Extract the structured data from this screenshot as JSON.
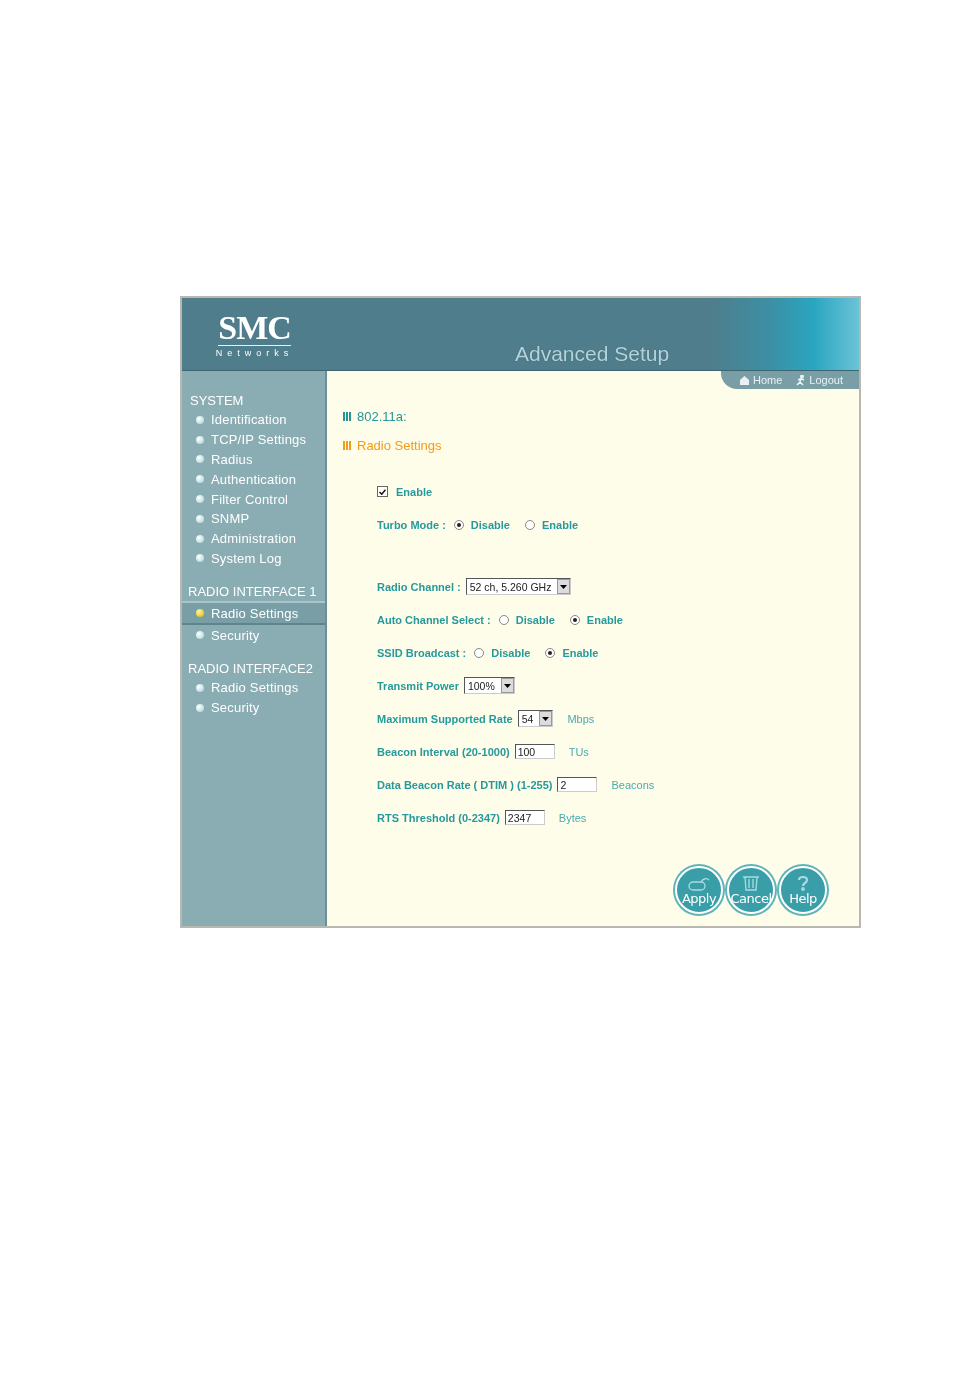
{
  "header": {
    "logo": "SMC",
    "logo_sub": "Networks",
    "title": "Advanced Setup",
    "nav": [
      {
        "kind": "home",
        "label": "Home"
      },
      {
        "kind": "logout",
        "label": "Logout"
      }
    ]
  },
  "sidebar": {
    "sections": [
      {
        "title": "SYSTEM",
        "items": [
          {
            "label": "Identification",
            "selected": false
          },
          {
            "label": "TCP/IP Settings",
            "selected": false
          },
          {
            "label": "Radius",
            "selected": false
          },
          {
            "label": "Authentication",
            "selected": false
          },
          {
            "label": "Filter Control",
            "selected": false
          },
          {
            "label": "SNMP",
            "selected": false
          },
          {
            "label": "Administration",
            "selected": false
          },
          {
            "label": "System Log",
            "selected": false
          }
        ]
      },
      {
        "title": "RADIO INTERFACE 1",
        "items": [
          {
            "label": "Radio Settings",
            "selected": true
          },
          {
            "label": "Security",
            "selected": false
          }
        ]
      },
      {
        "title": "RADIO INTERFACE2",
        "items": [
          {
            "label": "Radio Settings",
            "selected": false
          },
          {
            "label": "Security",
            "selected": false
          }
        ]
      }
    ]
  },
  "content": {
    "section": "802.11a:",
    "heading": "Radio Settings",
    "enable": {
      "label": "Enable",
      "checked": true
    },
    "mode_fields": [
      {
        "kind": "radio",
        "label": "Turbo Mode :",
        "options": [
          {
            "label": "Disable",
            "selected": true
          },
          {
            "label": "Enable",
            "selected": false
          }
        ]
      }
    ],
    "fields": [
      {
        "kind": "select",
        "label": "Radio Channel :",
        "value": "52 ch, 5.260 GHz"
      },
      {
        "kind": "radio",
        "label": "Auto Channel Select :",
        "options": [
          {
            "label": "Disable",
            "selected": false
          },
          {
            "label": "Enable",
            "selected": true
          }
        ]
      },
      {
        "kind": "radio",
        "label": "SSID Broadcast :",
        "options": [
          {
            "label": "Disable",
            "selected": false
          },
          {
            "label": "Enable",
            "selected": true
          }
        ]
      },
      {
        "kind": "select",
        "label": "Transmit Power",
        "value": "100%"
      },
      {
        "kind": "select",
        "label": "Maximum Supported Rate",
        "value": "54",
        "unit": "Mbps"
      },
      {
        "kind": "text",
        "label": "Beacon Interval (20-1000)",
        "value": "100",
        "unit": "TUs"
      },
      {
        "kind": "text",
        "label": "Data Beacon Rate ( DTIM ) (1-255)",
        "value": "2",
        "unit": "Beacons"
      },
      {
        "kind": "text",
        "label": "RTS Threshold (0-2347)",
        "value": "2347",
        "unit": "Bytes"
      }
    ]
  },
  "buttons": [
    {
      "kind": "apply",
      "label": "Apply"
    },
    {
      "kind": "cancel",
      "label": "Cancel"
    },
    {
      "kind": "help",
      "label": "Help"
    }
  ]
}
